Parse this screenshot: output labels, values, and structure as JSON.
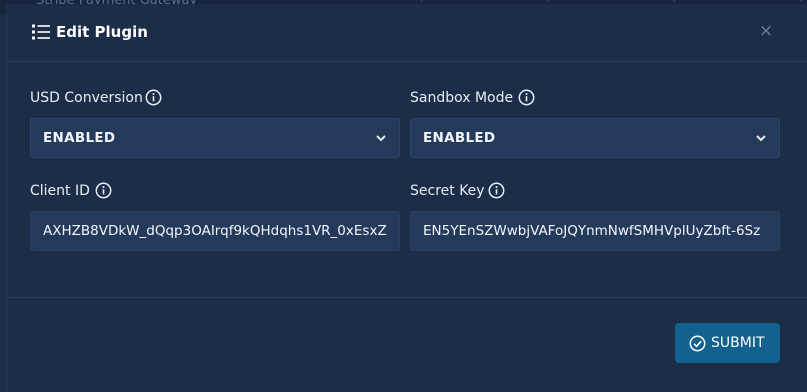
{
  "background": {
    "partial_text": "Stripe Payment Gateway"
  },
  "modal": {
    "title": "Edit Plugin",
    "title_icon": "list-icon",
    "close_label": "×"
  },
  "fields": {
    "usd_conversion": {
      "label": "USD Conversion",
      "value": "ENABLED",
      "icon": "info-icon"
    },
    "sandbox_mode": {
      "label": "Sandbox Mode",
      "value": "ENABLED",
      "icon": "info-icon"
    },
    "client_id": {
      "label": "Client ID",
      "value": "AXHZB8VDkW_dQqp3OAIrqf9kQHdqhs1VR_0xEsxZ",
      "icon": "info-icon"
    },
    "secret_key": {
      "label": "Secret Key",
      "value": "EN5YEnSZWwbjVAFoJQYnmNwfSMHVplUyZbft-6Sz",
      "icon": "info-icon"
    }
  },
  "footer": {
    "submit_label": "SUBMIT",
    "submit_icon": "check-circle-icon"
  },
  "colors": {
    "background": "#1b2d47",
    "field_background": "#243a5a",
    "submit_background": "#12618e",
    "text": "#e9eef5"
  }
}
